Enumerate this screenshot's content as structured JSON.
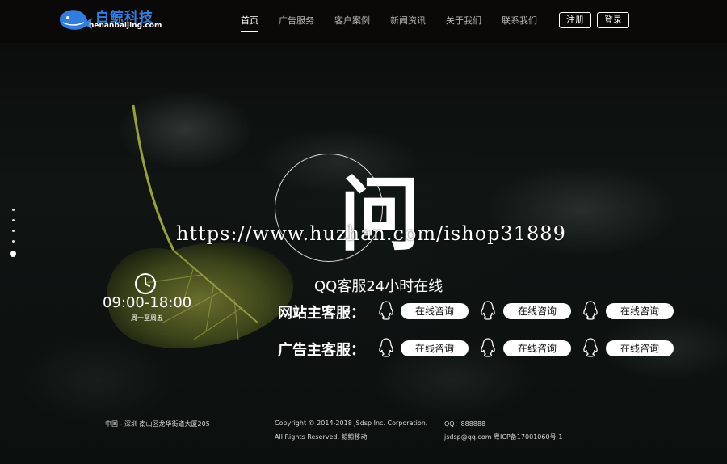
{
  "brand": {
    "name": "白鲸科技",
    "domain": "henanbaijing.com"
  },
  "nav": {
    "items": [
      {
        "label": "首页",
        "active": true
      },
      {
        "label": "广告服务",
        "active": false
      },
      {
        "label": "客户案例",
        "active": false
      },
      {
        "label": "新闻资讯",
        "active": false
      },
      {
        "label": "关于我们",
        "active": false
      },
      {
        "label": "联系我们",
        "active": false
      }
    ],
    "register_label": "注册",
    "login_label": "登录"
  },
  "hero": {
    "big_char": "问",
    "watermark": "https://www.huzhan.com/ishop31889",
    "service_title": "QQ客服24小时在线",
    "hours": "09:00-18:00",
    "days": "周一至周五",
    "rows": [
      {
        "label": "网站主客服：",
        "buttons": [
          "在线咨询",
          "在线咨询",
          "在线咨询"
        ]
      },
      {
        "label": "广告主客服：",
        "buttons": [
          "在线咨询",
          "在线咨询",
          "在线咨询"
        ]
      }
    ]
  },
  "footer": {
    "address": "中国 - 深圳 南山区龙华街道大厦205",
    "copyright_line1": "Copyright © 2014-2018 JSdsp Inc. Corporation.",
    "copyright_line2": "All Rights Reserved. 鲸鲸移动",
    "qq": "QQ：888888",
    "email_icp": "jsdsp@qq.com 粤ICP备17001060号-1"
  },
  "side_nav": {
    "dot_count": 5,
    "active_index": 4
  },
  "colors": {
    "brand_blue": "#2f7de0",
    "header_bg": "#0a0908",
    "button_bg": "#ffffff"
  },
  "icons": [
    "whale-logo-icon",
    "clock-icon",
    "qq-penguin-icon"
  ]
}
